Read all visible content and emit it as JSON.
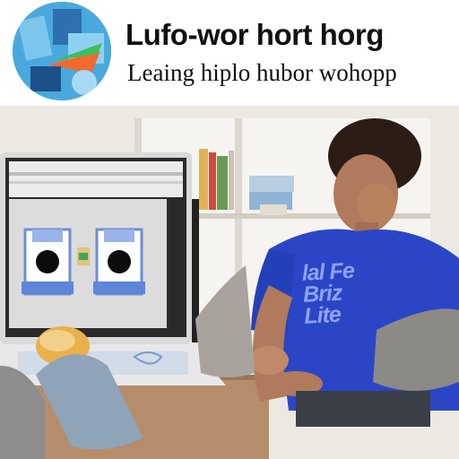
{
  "header": {
    "headline": "Lufo-wor hort horg",
    "subline": "Leaing hiplo hubor wohopp",
    "logo_icon": "abstract-illustration-logo"
  },
  "scene": {
    "tshirt_text": "lal Fe\nBriz\nLite"
  },
  "colors": {
    "tshirt": "#2a44c8",
    "screen_frame": "#1a1a1a",
    "wall": "#e9e6e0",
    "desk": "#b38b6a"
  }
}
